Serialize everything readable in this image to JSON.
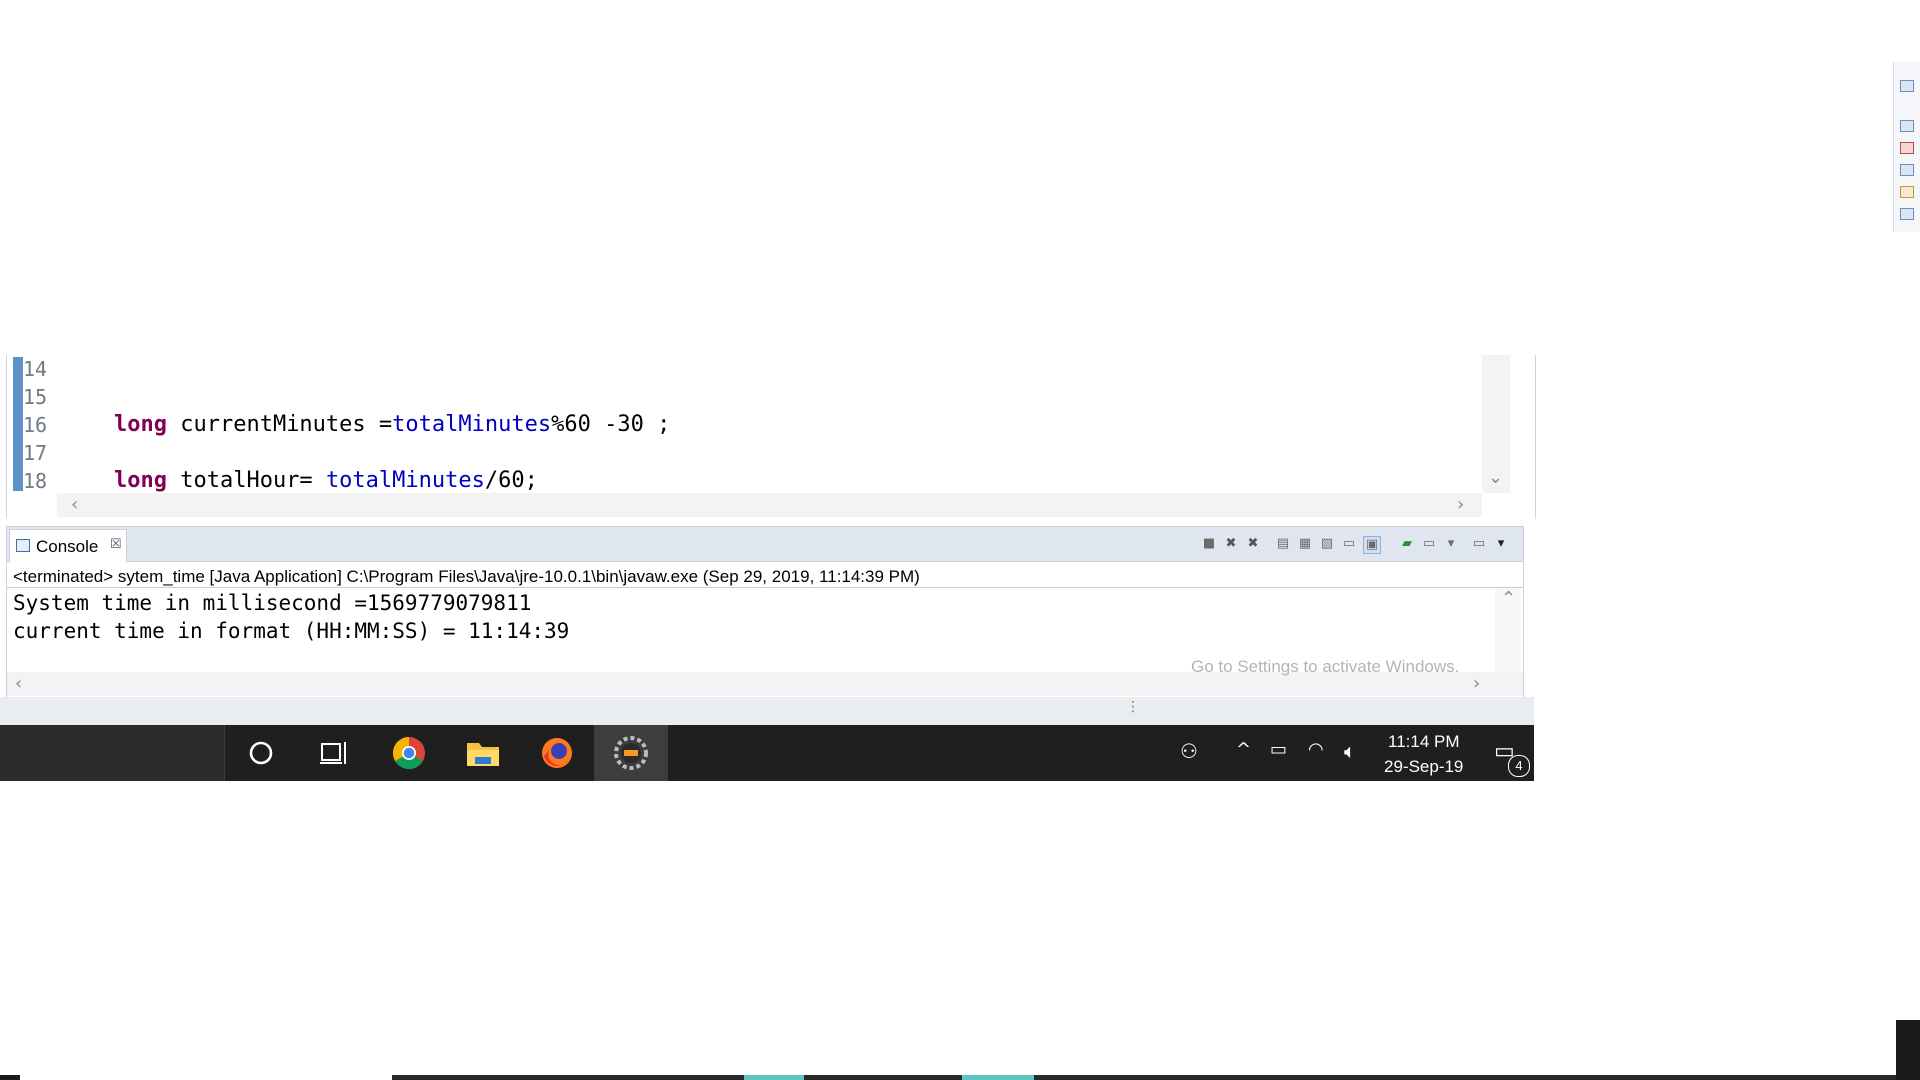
{
  "editor": {
    "line_numbers": [
      "14",
      "15",
      "16",
      "17",
      "18"
    ],
    "lines": [
      {
        "kw": "",
        "rest": "",
        "plain": ""
      },
      {
        "kw": "",
        "rest": "",
        "plain": ""
      },
      {
        "kw": "long",
        "var": " currentMinutes =",
        "field": "totalMinutes",
        "tail": "%60 -30 ;"
      },
      {
        "kw": "",
        "rest": "",
        "plain": ""
      },
      {
        "kw": "long",
        "var": " totalHour= ",
        "field": "totalMinutes",
        "tail": "/60;"
      }
    ]
  },
  "console": {
    "tab_label": "Console",
    "tab_close": "☒",
    "status": "<terminated> sytem_time [Java Application] C:\\Program Files\\Java\\jre-10.0.1\\bin\\javaw.exe (Sep 29, 2019, 11:14:39 PM)",
    "output": [
      "System time in millisecond =1569779079811",
      "current time in format (HH:MM:SS) = 11:14:39"
    ]
  },
  "watermark": "Go to Settings to activate Windows.",
  "taskbar": {
    "apps": [
      {
        "name": "cortana-icon"
      },
      {
        "name": "task-view-icon"
      },
      {
        "name": "chrome-icon"
      },
      {
        "name": "file-explorer-icon"
      },
      {
        "name": "firefox-icon"
      },
      {
        "name": "eclipse-icon"
      }
    ],
    "clock": {
      "time": "11:14 PM",
      "date": "29-Sep-19"
    },
    "notification_count": "4"
  },
  "colors": {
    "keyword": "#7f0055",
    "field": "#0000c0",
    "taskbar": "#1f1f1f",
    "accent": "#5e91c7"
  }
}
